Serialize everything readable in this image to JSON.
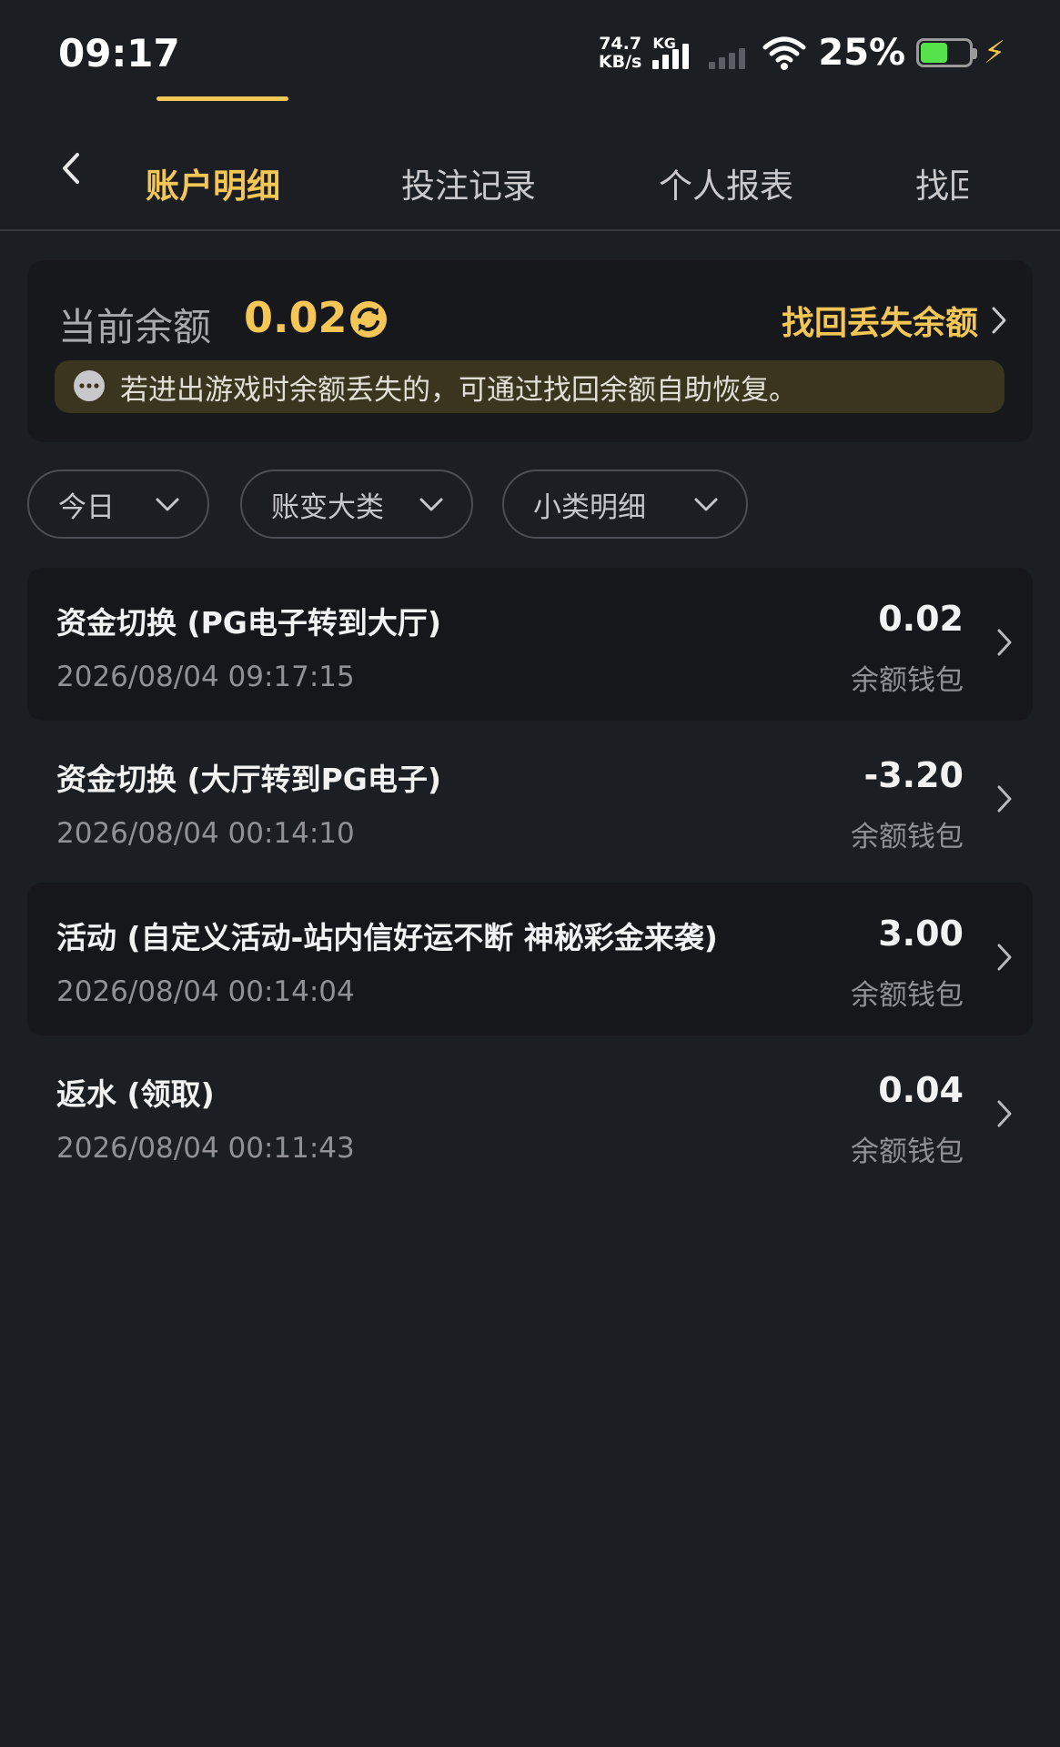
{
  "status_bar": {
    "time": "09:17",
    "net_speed_value": "74.7",
    "net_speed_unit": "KB/s",
    "signal_label": "KG",
    "battery_percent": "25%",
    "battery_level": 0.25,
    "battery_color": "#55e24a"
  },
  "tabs": [
    {
      "label": "账户明细",
      "active": true
    },
    {
      "label": "投注记录",
      "active": false
    },
    {
      "label": "个人报表",
      "active": false
    },
    {
      "label": "找回",
      "active": false
    }
  ],
  "balance": {
    "label": "当前余额",
    "value": "0.02",
    "recover_label": "找回丢失余额",
    "notice": "若进出游戏时余额丢失的，可通过找回余额自助恢复。"
  },
  "filters": [
    {
      "label": "今日"
    },
    {
      "label": "账变大类"
    },
    {
      "label": "小类明细"
    }
  ],
  "records": [
    {
      "title": "资金切换 (PG电子转到大厅)",
      "time": "2026/08/04 09:17:15",
      "amount": "0.02",
      "wallet": "余额钱包"
    },
    {
      "title": "资金切换 (大厅转到PG电子)",
      "time": "2026/08/04 00:14:10",
      "amount": "-3.20",
      "wallet": "余额钱包"
    },
    {
      "title": "活动 (自定义活动-站内信好运不断 神秘彩金来袭)",
      "time": "2026/08/04 00:14:04",
      "amount": "3.00",
      "wallet": "余额钱包"
    },
    {
      "title": "返水 (领取)",
      "time": "2026/08/04 00:11:43",
      "amount": "0.04",
      "wallet": "余额钱包"
    }
  ],
  "colors": {
    "accent": "#f4c655",
    "background": "#1b1e23",
    "card": "#16181c"
  }
}
